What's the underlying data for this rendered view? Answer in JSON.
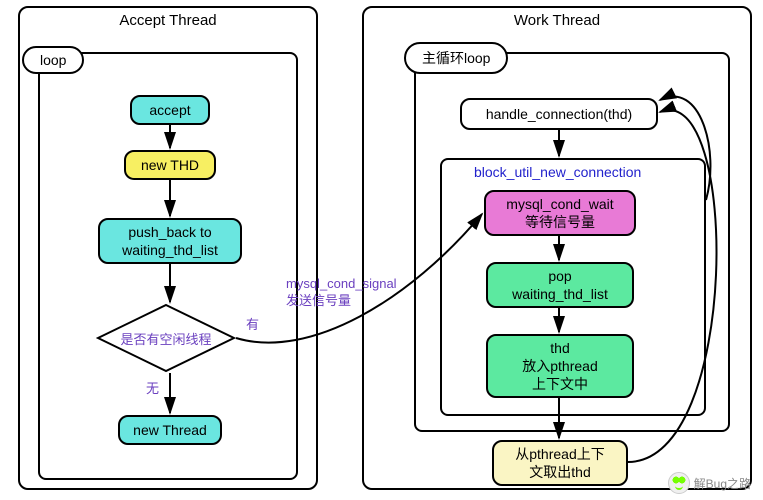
{
  "left": {
    "title": "Accept Thread",
    "loop_label": "loop",
    "nodes": {
      "accept": "accept",
      "new_thd": "new THD",
      "push_back_l1": "push_back to",
      "push_back_l2": "waiting_thd_list",
      "decision": "是否有空闲线程",
      "no": "无",
      "yes": "有",
      "new_thread": "new Thread"
    }
  },
  "right": {
    "title": "Work Thread",
    "loop_label": "主循环loop",
    "nodes": {
      "handle": "handle_connection(thd)",
      "block_util": "block_util_new_connection",
      "cond_wait_l1": "mysql_cond_wait",
      "cond_wait_l2": "等待信号量",
      "pop_l1": "pop",
      "pop_l2": "waiting_thd_list",
      "thd_l1": "thd",
      "thd_l2": "放入pthread",
      "thd_l3": "上下文中",
      "from_pthread_l1": "从pthread上下",
      "from_pthread_l2": "文取出thd"
    }
  },
  "signal": {
    "l1": "mysql_cond_signal",
    "l2": "发送信号量"
  },
  "watermark": "解Bug之路"
}
